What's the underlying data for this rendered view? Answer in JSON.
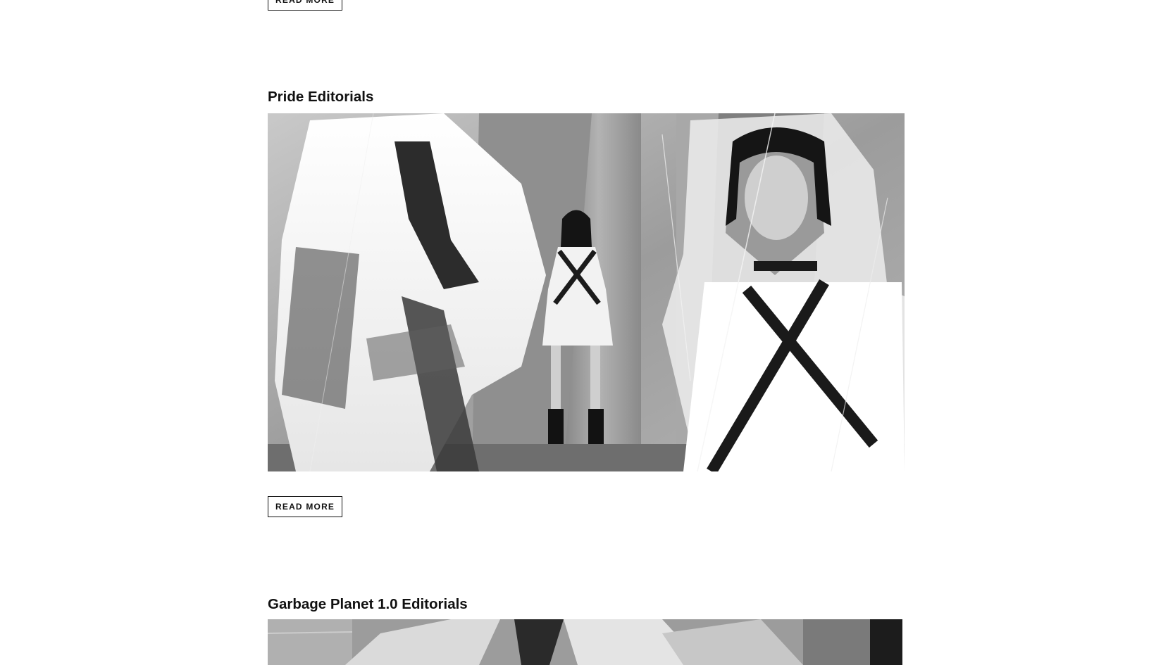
{
  "posts": [
    {
      "read_more_label": "READ MORE"
    },
    {
      "title": "Pride Editorials",
      "read_more_label": "READ MORE"
    },
    {
      "title": "Garbage Planet 1.0 Editorials"
    }
  ],
  "colors": {
    "background": "#ffffff",
    "text": "#111111",
    "button_border": "#111111"
  }
}
